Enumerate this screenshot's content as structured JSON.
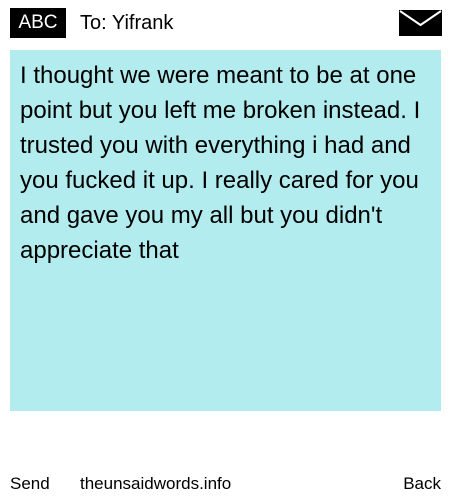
{
  "header": {
    "badge_label": "ABC",
    "recipient_label": "To: Yifrank",
    "mail_icon": "envelope-icon"
  },
  "message": {
    "text": "I thought we were meant to be at one point but you left me broken instead. I trusted you with everything i had and you fucked it up. I really cared for you and gave you my all but you didn't appreciate that",
    "background_color": "#b2ecee"
  },
  "footer": {
    "send_label": "Send",
    "site_label": "theunsaidwords.info",
    "back_label": "Back"
  }
}
